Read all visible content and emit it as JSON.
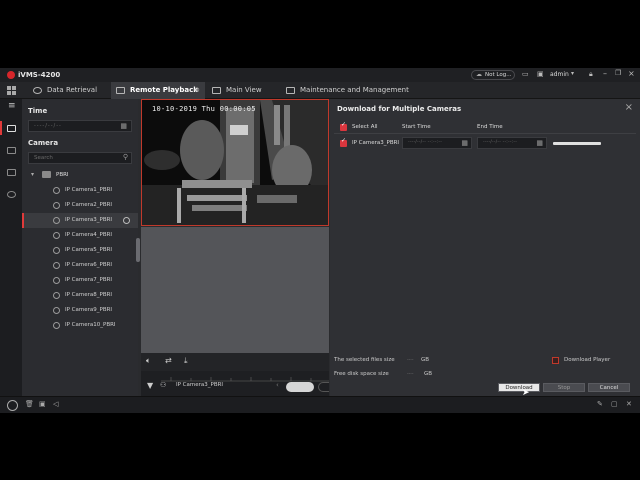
{
  "app": {
    "title": "iVMS-4200",
    "user": "admin",
    "not_logged": "Not Log..."
  },
  "tabs": [
    {
      "label": "Data Retrieval",
      "icon": "search-icon"
    },
    {
      "label": "Remote Playback",
      "icon": "playback-icon"
    },
    {
      "label": "Main View",
      "icon": "monitor-icon"
    },
    {
      "label": "Maintenance and Management",
      "icon": "wrench-icon"
    }
  ],
  "left": {
    "time_title": "Time",
    "date_placeholder": "----/--/--",
    "camera_title": "Camera",
    "search_placeholder": "Search",
    "group": "PBRI",
    "cameras": [
      "IP Camera1_PBRI",
      "IP Camera2_PBRI",
      "IP Camera3_PBRI",
      "IP Camera4_PBRI",
      "IP Camera5_PBRI",
      "IP Camera6_PBRI",
      "IP Camera7_PBRI",
      "IP Camera8_PBRI",
      "IP Camera9_PBRI",
      "IP Camera10_PBRI"
    ],
    "selected_index": 2
  },
  "player": {
    "osd": "10-10-2019 Thu 00:00:05",
    "channel": "IP Camera3_PBRI"
  },
  "dialog": {
    "title": "Download for Multiple Cameras",
    "select_all": "Select All",
    "start_time": "Start Time",
    "end_time": "End Time",
    "row_camera": "IP Camera3_PBRI",
    "start_placeholder": "----/--/-- --:--:--",
    "end_placeholder": "----/--/-- --:--:--",
    "selected_files_size_label": "The selected files size",
    "selected_files_size_value": "----",
    "selected_files_size_unit": "GB",
    "free_disk_label": "Free disk space size",
    "free_disk_value": "----",
    "free_disk_unit": "GB",
    "download_player": "Download Player",
    "btn_download": "Download",
    "btn_stop": "Stop",
    "btn_cancel": "Cancel"
  }
}
